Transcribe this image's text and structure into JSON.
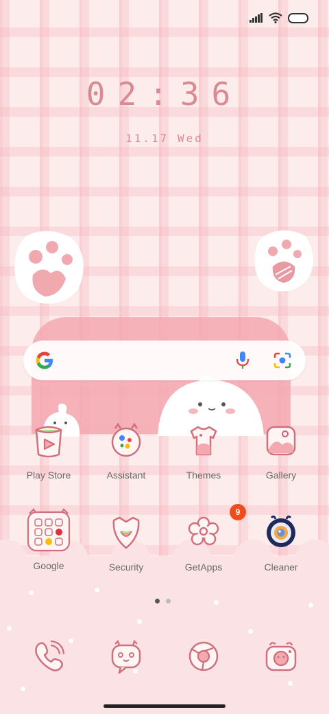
{
  "status_bar": {
    "signal_icon": "signal-icon",
    "wifi_icon": "wifi-icon",
    "battery_icon": "battery-icon"
  },
  "clock": {
    "time": "02:36",
    "date": "11.17 Wed"
  },
  "search": {
    "google_icon": "google-g-icon",
    "mic_icon": "mic-icon",
    "lens_icon": "lens-icon"
  },
  "apps_row1": [
    {
      "label": "Play Store",
      "icon": "play-store-icon"
    },
    {
      "label": "Assistant",
      "icon": "assistant-icon"
    },
    {
      "label": "Themes",
      "icon": "themes-icon"
    },
    {
      "label": "Gallery",
      "icon": "gallery-icon"
    }
  ],
  "apps_row2": [
    {
      "label": "Google",
      "icon": "google-folder-icon"
    },
    {
      "label": "Security",
      "icon": "security-icon"
    },
    {
      "label": "GetApps",
      "icon": "getapps-icon",
      "badge": "9"
    },
    {
      "label": "Cleaner",
      "icon": "cleaner-icon"
    }
  ],
  "pager": {
    "pages": 2,
    "active": 1
  },
  "dock": [
    {
      "icon": "phone-icon"
    },
    {
      "icon": "messages-icon"
    },
    {
      "icon": "browser-icon"
    },
    {
      "icon": "camera-icon"
    }
  ],
  "colors": {
    "accent": "#d98a93",
    "icon_stroke": "#d0707c",
    "badge": "#f04d1c"
  }
}
